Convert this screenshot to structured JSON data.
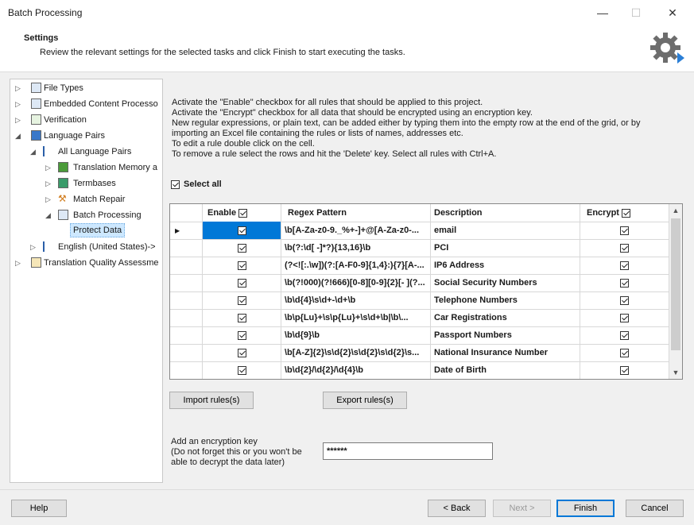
{
  "window": {
    "title": "Batch Processing",
    "minimize": "—",
    "maximize": "☐",
    "close": "✕"
  },
  "header": {
    "title": "Settings",
    "subtitle": "Review the relevant settings for the selected tasks and click Finish to start executing the tasks."
  },
  "tree": {
    "items": [
      {
        "label": "File Types",
        "icon": "settings-page-icon",
        "expander": "▷"
      },
      {
        "label": "Embedded Content Processo",
        "icon": "settings-page-icon",
        "expander": "▷"
      },
      {
        "label": "Verification",
        "icon": "verification-check-icon",
        "expander": "▷"
      },
      {
        "label": "Language Pairs",
        "icon": "language-pairs-icon",
        "expander": "◢"
      },
      {
        "label": "All Language Pairs",
        "icon": "flag-icon",
        "expander": "◢"
      },
      {
        "label": "Translation Memory a",
        "icon": "translation-memory-icon",
        "expander": "▷"
      },
      {
        "label": "Termbases",
        "icon": "termbase-icon",
        "expander": "▷"
      },
      {
        "label": "Match Repair",
        "icon": "wrench-icon",
        "expander": "▷"
      },
      {
        "label": "Batch Processing",
        "icon": "batch-settings-icon",
        "expander": "◢"
      },
      {
        "label": "Protect Data",
        "icon": "",
        "expander": ""
      },
      {
        "label": "English (United States)->",
        "icon": "flag-icon",
        "expander": "▷"
      },
      {
        "label": "Translation Quality Assessme",
        "icon": "quality-assessment-icon",
        "expander": "▷"
      }
    ]
  },
  "instructions": [
    "Activate the \"Enable\" checkbox for all rules that should be applied to this project.",
    "Activate the \"Encrypt\" checkbox for all data that should be encrypted using an encryption key.",
    "New regular expressions, or plain text, can be added either by typing them into the empty row at the end of the grid, or by",
    "importing an Excel file containing the rules or lists of names, addresses etc.",
    "To edit a rule double click on the cell.",
    "To remove a rule select the rows and hit the 'Delete' key.  Select all rules with Ctrl+A."
  ],
  "select_all": {
    "label": "Select all",
    "checked": true
  },
  "grid": {
    "columns": {
      "enable": "Enable",
      "pattern": "Regex Pattern",
      "description": "Description",
      "encrypt": "Encrypt"
    },
    "current_row_marker": "▶",
    "rows": [
      {
        "enable": true,
        "pattern": "\\b[A-Za-z0-9._%+-]+@[A-Za-z0-...",
        "description": "email",
        "encrypt": true
      },
      {
        "enable": true,
        "pattern": "\\b(?:\\d[ -]*?){13,16}\\b",
        "description": "PCI",
        "encrypt": true
      },
      {
        "enable": true,
        "pattern": "(?<![:.\\w])(?:[A-F0-9]{1,4}:){7}[A-...",
        "description": "IP6 Address",
        "encrypt": true
      },
      {
        "enable": true,
        "pattern": "\\b(?!000)(?!666)[0-8][0-9]{2}[- ](?...",
        "description": "Social Security Numbers",
        "encrypt": true
      },
      {
        "enable": true,
        "pattern": "\\b\\d{4}\\s\\d+-\\d+\\b",
        "description": "Telephone Numbers",
        "encrypt": true
      },
      {
        "enable": true,
        "pattern": "\\b\\p{Lu}+\\s\\p{Lu}+\\s\\d+\\b|\\b\\...",
        "description": "Car Registrations",
        "encrypt": true
      },
      {
        "enable": true,
        "pattern": "\\b\\d{9}\\b",
        "description": "Passport Numbers",
        "encrypt": true
      },
      {
        "enable": true,
        "pattern": "\\b[A-Z]{2}\\s\\d{2}\\s\\d{2}\\s\\d{2}\\s...",
        "description": "National Insurance Number",
        "encrypt": true
      },
      {
        "enable": true,
        "pattern": "\\b\\d{2}/\\d{2}/\\d{4}\\b",
        "description": "Date of Birth",
        "encrypt": true
      }
    ]
  },
  "buttons": {
    "import": "Import rules(s)",
    "export": "Export rules(s)",
    "help": "Help",
    "back": "< Back",
    "next": "Next >",
    "finish": "Finish",
    "cancel": "Cancel"
  },
  "encryption": {
    "label_line1": "Add an encryption key",
    "label_line2": "(Do not forget this or you won't be",
    "label_line3": "able to decrypt the data later)",
    "value": "******"
  },
  "colors": {
    "accent": "#0078d7",
    "selection": "#cde8ff",
    "gear": "#6d6d6d"
  }
}
